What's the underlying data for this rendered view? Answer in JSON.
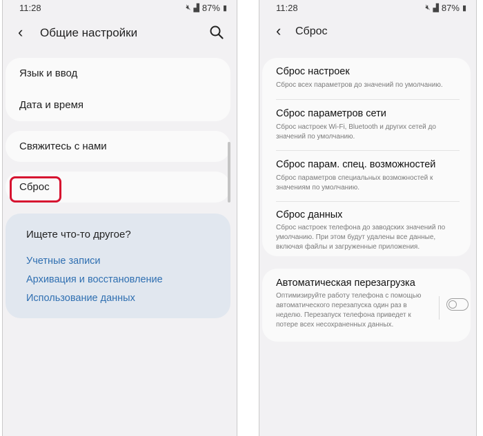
{
  "left": {
    "status": {
      "time": "11:28",
      "battery": "87%"
    },
    "header": {
      "title": "Общие настройки"
    },
    "menu": {
      "language": "Язык и ввод",
      "datetime": "Дата и время",
      "contact": "Свяжитесь с нами",
      "reset": "Сброс"
    },
    "suggest": {
      "title": "Ищете что-то другое?",
      "links": [
        "Учетные записи",
        "Архивация и восстановление",
        "Использование данных"
      ]
    }
  },
  "right": {
    "status": {
      "time": "11:28",
      "battery": "87%"
    },
    "header": {
      "title": "Сброс"
    },
    "items": [
      {
        "title": "Сброс настроек",
        "desc": "Сброс всех параметров до значений по умолчанию."
      },
      {
        "title": "Сброс параметров сети",
        "desc": "Сброс настроек Wi-Fi, Bluetooth и других сетей до значений по умолчанию."
      },
      {
        "title": "Сброс парам. спец. возможностей",
        "desc": "Сброс параметров специальных возможностей к значениям по умолчанию."
      },
      {
        "title": "Сброс данных",
        "desc": "Сброс настроек телефона до заводских значений по умолчанию. При этом будут удалены все данные, включая файлы и загруженные приложения."
      }
    ],
    "auto_restart": {
      "title": "Автоматическая перезагрузка",
      "desc": "Оптимизируйте работу телефона с помощью автоматического перезапуска один раз в неделю. Перезапуск телефона приведет к потере всех несохраненных данных.",
      "enabled": false
    }
  },
  "colors": {
    "highlight": "#d6112f",
    "link": "#2f6fb1",
    "suggest_bg": "#e1e7ef"
  }
}
